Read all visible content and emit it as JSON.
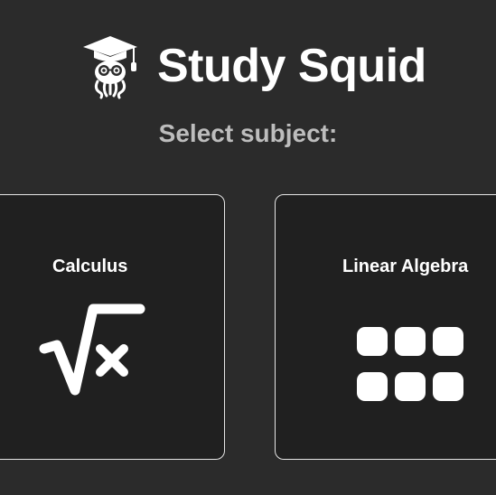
{
  "header": {
    "title": "Study Squid",
    "logo_icon": "squid-graduate-icon"
  },
  "subtitle": "Select subject:",
  "subjects": [
    {
      "label": "Calculus",
      "icon": "sqrt-x-icon"
    },
    {
      "label": "Linear Algebra",
      "icon": "matrix-grid-icon"
    }
  ],
  "colors": {
    "background": "#2b2b2b",
    "card_background": "#202020",
    "card_border": "#e6e6e6",
    "title_text": "#ffffff",
    "subtitle_text": "#bdbdbd"
  }
}
